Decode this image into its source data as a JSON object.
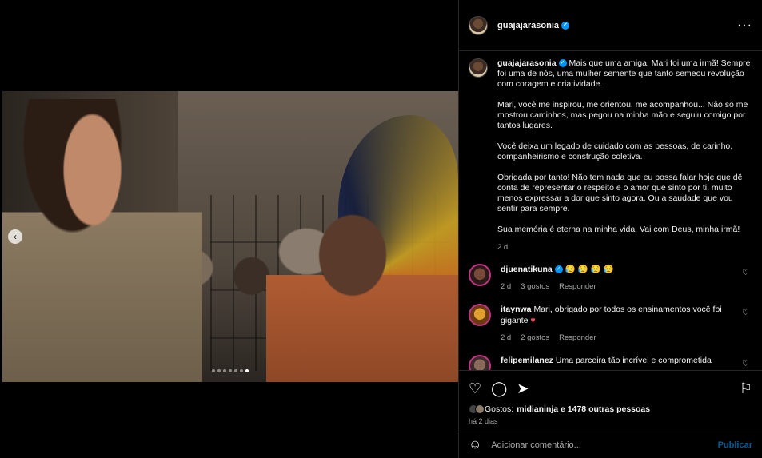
{
  "post": {
    "username": "guajajarasonia",
    "more_icon": "more-horizontal-icon"
  },
  "caption": {
    "username": "guajajarasonia",
    "paragraphs": [
      "Mais que uma amiga, Mari foi uma irmã! Sempre foi uma de nós, uma mulher semente que tanto semeou revolução com coragem e criatividade.",
      "Mari, você me inspirou, me orientou, me acompanhou... Não só me mostrou caminhos, mas pegou na minha mão e seguiu comigo por tantos lugares.",
      "Você deixa um legado de cuidado com as pessoas, de carinho, companheirismo e construção coletiva.",
      "Obrigada por tanto! Não tem nada que eu possa falar hoje que dê conta de representar o respeito e o amor que sinto por ti, muito menos expressar a dor que sinto agora. Ou a saudade que vou sentir para sempre.",
      "Sua memória é eterna na minha vida. Vai com Deus, minha irmã!"
    ],
    "time": "2 d"
  },
  "comments": [
    {
      "username": "djuenatikuna",
      "text": "😥 😥 😥 😥",
      "time": "2 d",
      "likes": "3 gostos",
      "reply": "Responder"
    },
    {
      "username": "itaynwa",
      "text": "Mari, obrigado por todos os ensinamentos você foi gigante",
      "heart": "♥",
      "time": "2 d",
      "likes": "2 gostos",
      "reply": "Responder"
    },
    {
      "username": "felipemilanez",
      "text": "Uma parceira tão incrível e comprometida"
    }
  ],
  "actions": {
    "likes_prefix": "Gostos: ",
    "likes_text": "midianinja e 1478 outras pessoas",
    "time": "há 2 dias"
  },
  "add_comment": {
    "placeholder": "Adicionar comentário...",
    "publish": "Publicar"
  },
  "carousel": {
    "total_dots": 7,
    "active_dot": 7
  },
  "colors": {
    "accent": "#0095f6",
    "heart": "#ed4956"
  }
}
